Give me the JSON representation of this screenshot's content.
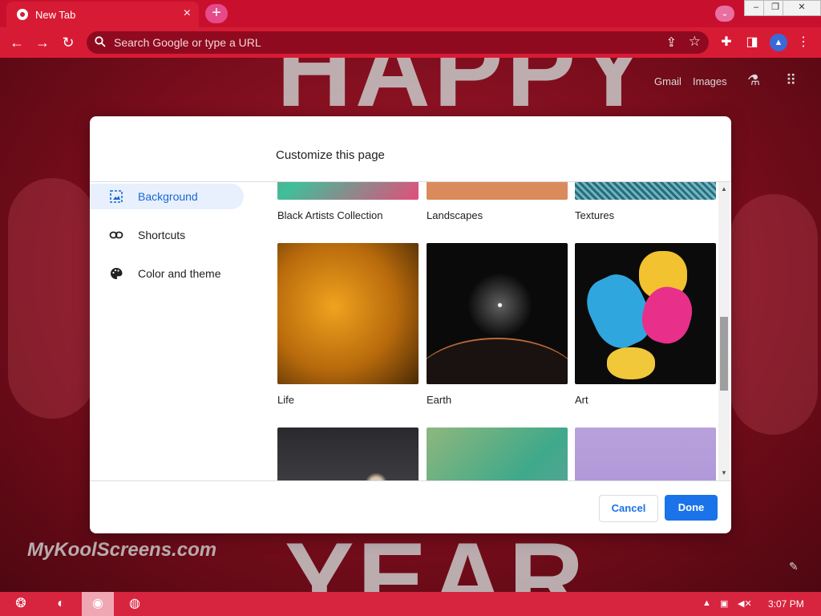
{
  "browser": {
    "tab_title": "New Tab",
    "omnibox_placeholder": "Search Google or type a URL"
  },
  "ntp": {
    "links": [
      "Gmail",
      "Images"
    ],
    "background_text_top": "HAPPY",
    "background_text_bottom": "YEAR",
    "watermark": "MyKoolScreens.com"
  },
  "dialog": {
    "title": "Customize this page",
    "menu": [
      {
        "label": "Background",
        "icon": "image-icon",
        "active": true
      },
      {
        "label": "Shortcuts",
        "icon": "link-icon",
        "active": false
      },
      {
        "label": "Color and theme",
        "icon": "palette-icon",
        "active": false
      }
    ],
    "collections": [
      {
        "label": "Black Artists Collection"
      },
      {
        "label": "Landscapes"
      },
      {
        "label": "Textures"
      },
      {
        "label": "Life"
      },
      {
        "label": "Earth"
      },
      {
        "label": "Art"
      }
    ],
    "cancel_label": "Cancel",
    "done_label": "Done"
  },
  "taskbar": {
    "time": "3:07 PM"
  },
  "colors": {
    "accent": "#1a73e8",
    "chrome_red": "#d81b35",
    "active_menu_bg": "#e8f0fe"
  }
}
